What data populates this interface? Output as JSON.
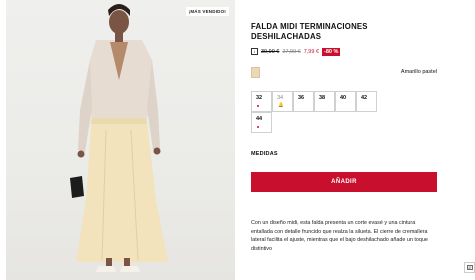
{
  "gallery": {
    "badge": "¡MÁS VENDIDO!"
  },
  "product": {
    "title": "FALDA MIDI TERMINACIONES DESHILACHADAS",
    "price": {
      "original": "39,99 €",
      "previous": "27,99 €",
      "current": "7,99 €",
      "discount": "-80 %"
    },
    "color": {
      "name": "Amarillo pastel",
      "swatch": "#ecd7b6"
    },
    "sizes": [
      {
        "label": "32",
        "indicator": "dot"
      },
      {
        "label": "34",
        "indicator": "bell"
      },
      {
        "label": "36",
        "indicator": ""
      },
      {
        "label": "38",
        "indicator": ""
      },
      {
        "label": "40",
        "indicator": ""
      },
      {
        "label": "42",
        "indicator": ""
      },
      {
        "label": "44",
        "indicator": "dot"
      }
    ],
    "measures_label": "MEDIDAS",
    "add_button": "AÑADIR",
    "description": "Con un diseño midi, esta falda presenta un corte evasé y una cintura entallada con detalle fruncido que realza la silueta. El cierre de cremallera lateral facilita el ajuste, mientras que el bajo deshilachado añade un toque distintivo"
  },
  "theme": {
    "accent": "#c8102e"
  }
}
